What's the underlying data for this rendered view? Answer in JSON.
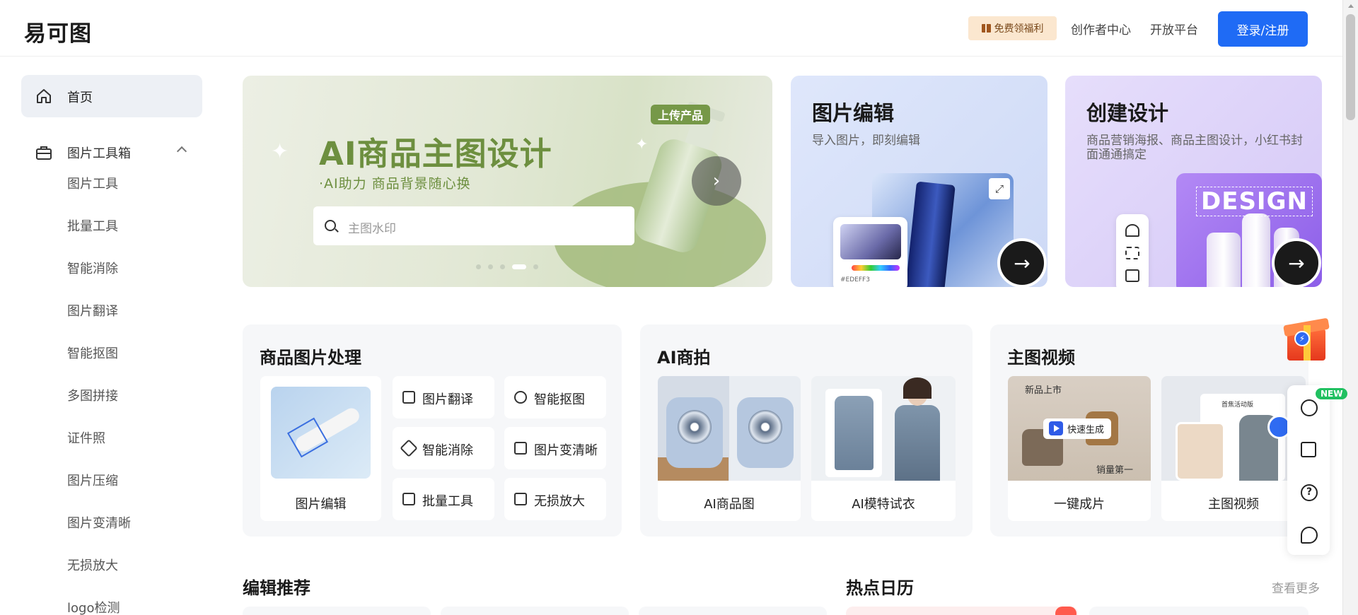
{
  "header": {
    "logo": "易可图",
    "benefit_label": "免费领福利",
    "creator_center": "创作者中心",
    "open_platform": "开放平台",
    "login_label": "登录/注册"
  },
  "sidebar": {
    "home": "首页",
    "toolbox": "图片工具箱",
    "sub_items": [
      "图片工具",
      "批量工具",
      "智能消除",
      "图片翻译",
      "智能抠图",
      "多图拼接",
      "证件照",
      "图片压缩",
      "图片变清晰",
      "无损放大",
      "logo检测"
    ]
  },
  "banner": {
    "tag": "上传产品",
    "title": "AI商品主图设计",
    "subtitle": "·AI助力 商品背景随心换",
    "search_placeholder": "主图水印",
    "dots": 5,
    "active_dot": 4
  },
  "cards": {
    "edit": {
      "title": "图片编辑",
      "desc": "导入图片，即刻编辑",
      "hex": "#EDEFF3"
    },
    "design": {
      "title": "创建设计",
      "desc": "商品营销海报、商品主图设计，小红书封面通通搞定",
      "word": "DESIGN"
    }
  },
  "floating": {
    "new_badge": "NEW"
  },
  "panels": {
    "product": {
      "title": "商品图片处理",
      "main_tile": "图片编辑",
      "chips": [
        "图片翻译",
        "智能抠图",
        "智能消除",
        "图片变清晰",
        "批量工具",
        "无损放大"
      ]
    },
    "ai_shoot": {
      "title": "AI商拍",
      "tiles": [
        "AI商品图",
        "AI模特试衣"
      ]
    },
    "video": {
      "title": "主图视频",
      "tiles": [
        "一键成片",
        "主图视频"
      ],
      "tag_new": "新品上市",
      "play_label": "快速生成",
      "tag_sales": "销量第一",
      "poster_title": "首焦活动版"
    }
  },
  "sections": {
    "recommend": "编辑推荐",
    "calendar": "热点日历",
    "more": "查看更多"
  }
}
